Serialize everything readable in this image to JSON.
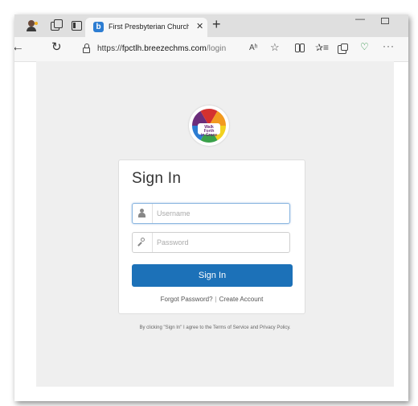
{
  "browser": {
    "tab_title": "First Presbyterian Church, Tallahe",
    "favicon_letter": "b",
    "close_glyph": "✕",
    "newtab_glyph": "+",
    "minimize_glyph": "—",
    "url_prefix": "https://",
    "url_host": "fpctlh.breezechms.com",
    "url_path": "/login",
    "back_glyph": "←",
    "refresh_glyph": "↻",
    "read_aloud_glyph": "Aʰ",
    "favorite_glyph": "☆",
    "favorites_glyph": "✰≡",
    "health_glyph": "♡",
    "more_glyph": "···"
  },
  "logo": {
    "line1": "Walk Forth",
    "line2": "in Grace",
    "colors": [
      "#6b2d7b",
      "#d4312f",
      "#f29a1f",
      "#f2d21f",
      "#3aa14a",
      "#2d7dd2"
    ]
  },
  "signin": {
    "title": "Sign In",
    "username_placeholder": "Username",
    "password_placeholder": "Password",
    "button_label": "Sign In",
    "forgot_link": "Forgot Password?",
    "separator": "|",
    "create_link": "Create Account",
    "button_color": "#1c71b8"
  },
  "footer": {
    "terms_text": "By clicking \"Sign In\" I agree to the Terms of Service and Privacy Policy."
  }
}
